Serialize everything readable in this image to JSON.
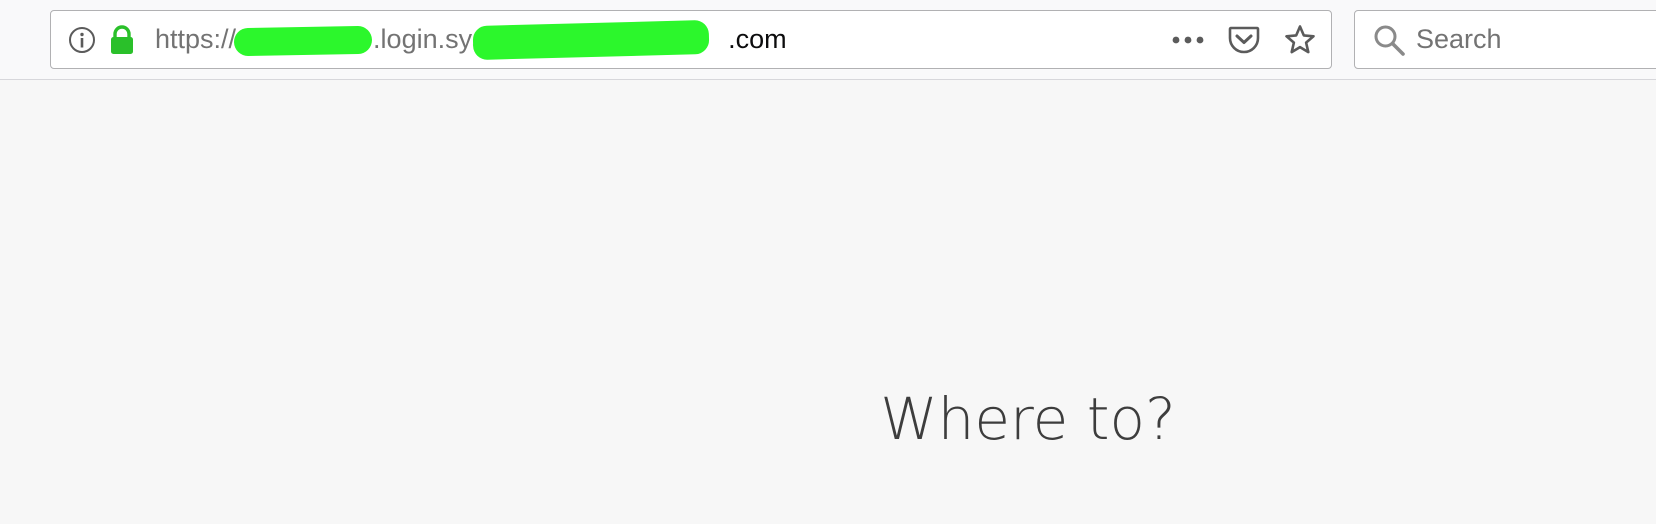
{
  "browser": {
    "url": {
      "scheme": "https://",
      "middle": ".login.sys.",
      "tld": ".com"
    },
    "search": {
      "placeholder": "Search"
    },
    "icons": {
      "info": "info-icon",
      "lock": "lock-icon",
      "more": "more-icon",
      "pocket": "pocket-icon",
      "bookmark": "star-icon",
      "search": "search-icon"
    },
    "colors": {
      "lock": "#2ac02a",
      "redaction": "#2cf72c"
    }
  },
  "page": {
    "heading": "Where to?"
  }
}
